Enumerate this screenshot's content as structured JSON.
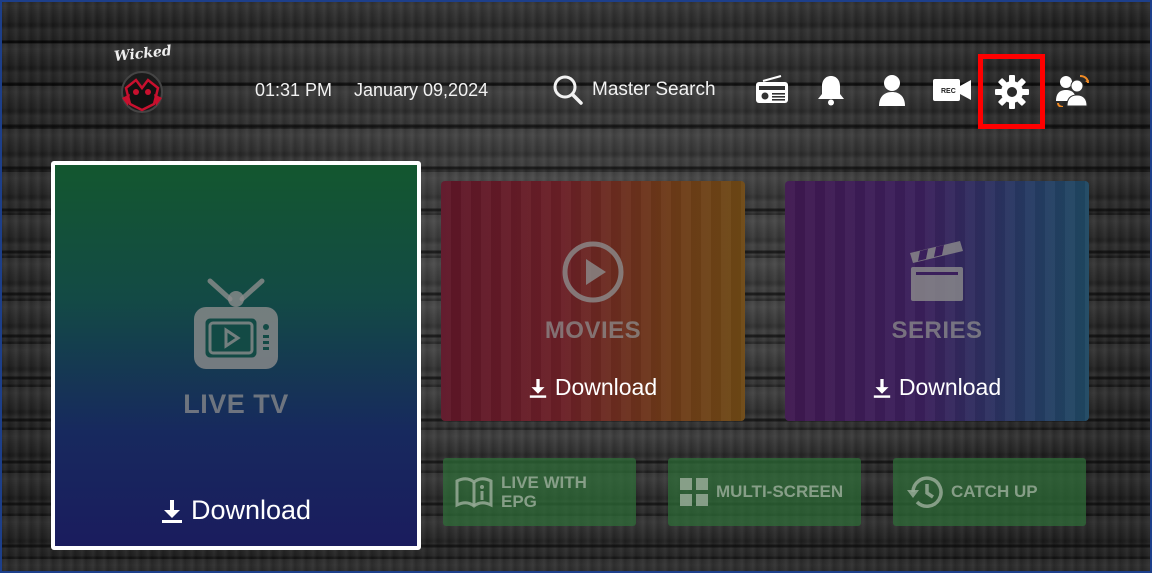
{
  "header": {
    "logo_text": "Wicked",
    "time": "01:31 PM",
    "date": "January 09,2024",
    "search_label": "Master Search",
    "icons": [
      "radio-icon",
      "bell-icon",
      "user-icon",
      "rec-camera-icon",
      "gear-icon",
      "switch-user-icon"
    ],
    "rec_label": "REC",
    "highlight_color": "#ff0000"
  },
  "tiles": {
    "live_tv": {
      "title": "LIVE TV",
      "download_label": "Download",
      "icon": "tv-icon"
    },
    "movies": {
      "title": "MOVIES",
      "download_label": "Download",
      "icon": "play-circle-icon"
    },
    "series": {
      "title": "SERIES",
      "download_label": "Download",
      "icon": "clapperboard-icon"
    }
  },
  "buttons": {
    "epg_line1": "LIVE WITH",
    "epg_line2": "EPG",
    "multi_screen": "MULTI-SCREEN",
    "catch_up": "CATCH UP"
  },
  "colors": {
    "live_tv_top": "#13572f",
    "live_tv_bottom": "#1a1c5e",
    "movies_left": "#5e1628",
    "movies_right": "#6e4915",
    "series_left": "#3f1850",
    "series_right": "#1f4862",
    "small_button": "#2e6e38",
    "focus_border": "#ffffff"
  }
}
